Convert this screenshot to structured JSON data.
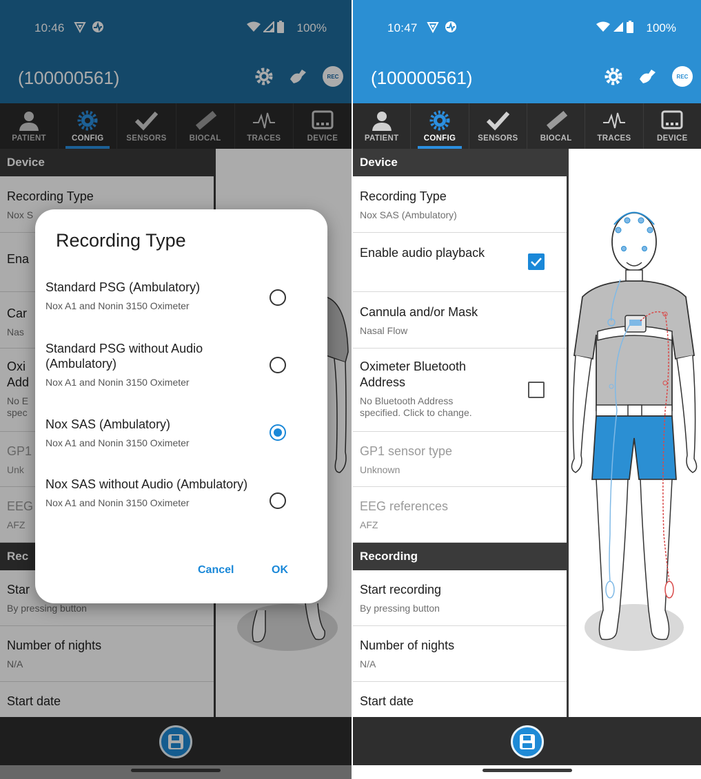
{
  "colors": {
    "accent": "#1a88d8",
    "left_header": "#1f6c9d",
    "right_header": "#2b8fd3"
  },
  "left": {
    "status": {
      "time": "10:46",
      "battery": "100%"
    },
    "appbar": {
      "title": "(100000561)",
      "rec": "REC"
    },
    "tabs": [
      {
        "label": "PATIENT",
        "icon": "person-icon"
      },
      {
        "label": "CONFIG",
        "icon": "gear-icon"
      },
      {
        "label": "SENSORS",
        "icon": "check-icon"
      },
      {
        "label": "BIOCAL",
        "icon": "ruler-icon"
      },
      {
        "label": "TRACES",
        "icon": "waveform-icon"
      },
      {
        "label": "DEVICE",
        "icon": "device-icon"
      }
    ],
    "bg_rows": {
      "device_header": "Device",
      "recording_type": "Recording Type",
      "recording_type_sub": "Nox S",
      "ena": "Ena",
      "can": "Car",
      "can_sub": "Nas",
      "oxi1": "Oxi",
      "oxi2": "Add",
      "oxi_sub1": "No E",
      "oxi_sub2": "spec",
      "gp": "GP1",
      "gp_sub": "Unk",
      "eeg": "EEG",
      "eeg_sub": "AFZ",
      "rec_header": "Rec",
      "start": "Star",
      "start_sub": "By pressing button",
      "nights": "Number of nights",
      "nights_sub": "N/A",
      "start_date": "Start date"
    },
    "dialog": {
      "title": "Recording Type",
      "options": [
        {
          "title": "Standard PSG (Ambulatory)",
          "sub": "Nox A1 and Nonin 3150 Oximeter",
          "selected": false
        },
        {
          "title": "Standard PSG without Audio (Ambulatory)",
          "sub": "Nox A1 and Nonin 3150 Oximeter",
          "selected": false
        },
        {
          "title": "Nox SAS (Ambulatory)",
          "sub": "Nox A1 and Nonin 3150 Oximeter",
          "selected": true
        },
        {
          "title": "Nox SAS without Audio (Ambulatory)",
          "sub": "Nox A1 and Nonin 3150 Oximeter",
          "selected": false
        }
      ],
      "cancel": "Cancel",
      "ok": "OK"
    }
  },
  "right": {
    "status": {
      "time": "10:47",
      "battery": "100%"
    },
    "appbar": {
      "title": "(100000561)",
      "rec": "REC"
    },
    "tabs": [
      {
        "label": "PATIENT",
        "icon": "person-icon"
      },
      {
        "label": "CONFIG",
        "icon": "gear-icon"
      },
      {
        "label": "SENSORS",
        "icon": "check-icon"
      },
      {
        "label": "BIOCAL",
        "icon": "ruler-icon"
      },
      {
        "label": "TRACES",
        "icon": "waveform-icon"
      },
      {
        "label": "DEVICE",
        "icon": "device-icon"
      }
    ],
    "device_header": "Device",
    "rows": {
      "recording_type": {
        "title": "Recording Type",
        "sub": "Nox SAS (Ambulatory)"
      },
      "audio": {
        "title": "Enable audio playback",
        "checked": true
      },
      "cannula": {
        "title": "Cannula and/or Mask",
        "sub": "Nasal Flow"
      },
      "oximeter": {
        "title1": "Oximeter Bluetooth",
        "title2": "Address",
        "sub1": "No Bluetooth Address",
        "sub2": "specified. Click to change.",
        "checked": false
      },
      "gp1": {
        "title": "GP1 sensor type",
        "sub": "Unknown"
      },
      "eeg": {
        "title": "EEG references",
        "sub": "AFZ"
      }
    },
    "recording_header": "Recording",
    "recording_rows": {
      "start": {
        "title": "Start recording",
        "sub": "By pressing button"
      },
      "nights": {
        "title": "Number of nights",
        "sub": "N/A"
      },
      "start_date": {
        "title": "Start date"
      }
    }
  }
}
